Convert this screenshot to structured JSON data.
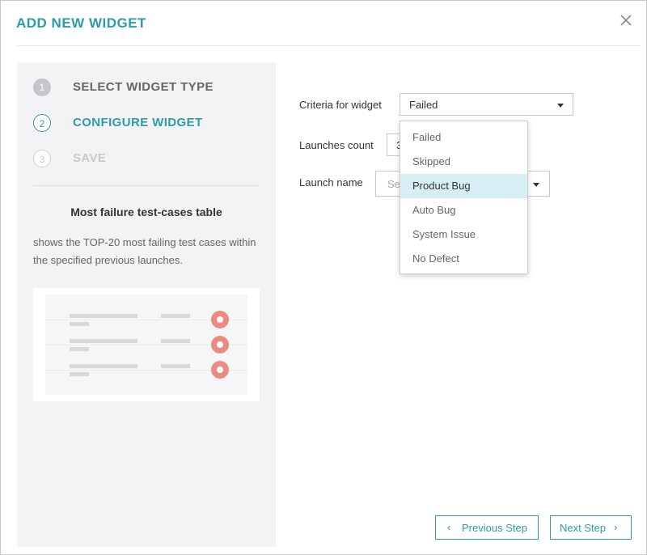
{
  "modal": {
    "title": "ADD NEW WIDGET",
    "close_icon": "close-icon"
  },
  "steps": [
    {
      "number": "1",
      "label": "SELECT WIDGET TYPE",
      "state": "done"
    },
    {
      "number": "2",
      "label": "CONFIGURE WIDGET",
      "state": "active"
    },
    {
      "number": "3",
      "label": "SAVE",
      "state": "disabled"
    }
  ],
  "widget": {
    "name": "Most failure test-cases table",
    "description": "shows the TOP-20 most failing test cases within the specified previous launches."
  },
  "form": {
    "criteria": {
      "label": "Criteria for widget",
      "value": "Failed"
    },
    "launches_count": {
      "label": "Launches count",
      "value": "3"
    },
    "launch_name": {
      "label": "Launch name",
      "placeholder": "Sel"
    }
  },
  "dropdown": {
    "options": [
      "Failed",
      "Skipped",
      "Product Bug",
      "Auto Bug",
      "System Issue",
      "No Defect"
    ],
    "highlighted": "Product Bug"
  },
  "buttons": {
    "previous": "Previous Step",
    "next": "Next Step"
  },
  "colors": {
    "accent": "#2e9bab",
    "highlight": "#d6eef4",
    "preview_dot": "#e88d80"
  }
}
